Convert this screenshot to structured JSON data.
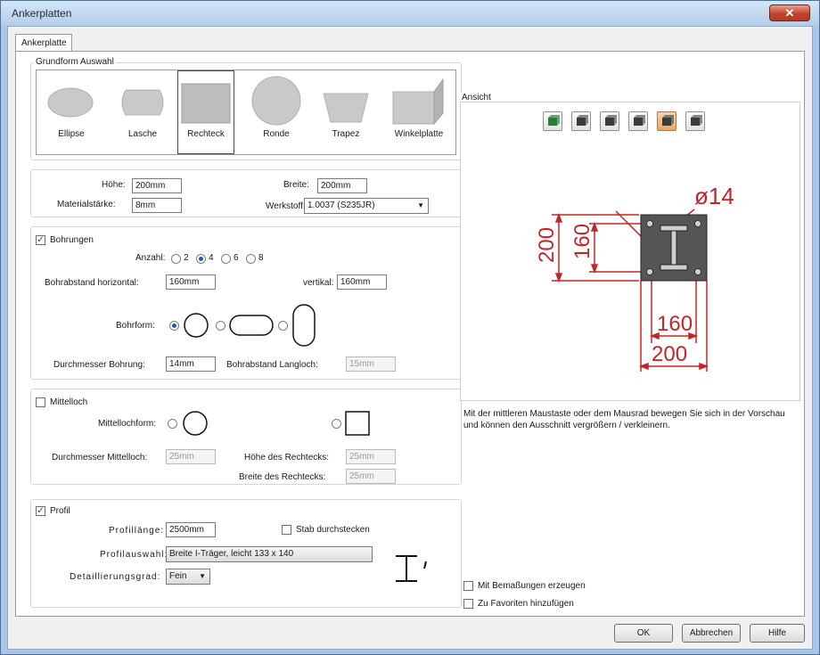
{
  "window": {
    "title": "Ankerplatten",
    "close_label": "✕"
  },
  "tab": {
    "label": "Ankerplatte"
  },
  "shape_group": {
    "label": "Grundform Auswahl",
    "shapes": [
      {
        "label": "Ellipse"
      },
      {
        "label": "Lasche"
      },
      {
        "label": "Rechteck"
      },
      {
        "label": "Ronde"
      },
      {
        "label": "Trapez"
      },
      {
        "label": "Winkelplatte"
      }
    ]
  },
  "dimensions": {
    "hoehe_label": "Höhe:",
    "hoehe_value": "200mm",
    "breite_label": "Breite:",
    "breite_value": "200mm",
    "material_label": "Materialstärke:",
    "material_value": "8mm",
    "werkstoff_label": "Werkstoff:",
    "werkstoff_value": "1.0037 (S235JR)"
  },
  "bohrungen": {
    "label": "Bohrungen",
    "anzahl_label": "Anzahl:",
    "anzahl_options": [
      "2",
      "4",
      "6",
      "8"
    ],
    "abstand_h_label": "Bohrabstand horizontal:",
    "abstand_h_value": "160mm",
    "vertikal_label": "vertikal:",
    "vertikal_value": "160mm",
    "bohrform_label": "Bohrform:",
    "durchmesser_label": "Durchmesser Bohrung:",
    "durchmesser_value": "14mm",
    "langloch_label": "Bohrabstand Langloch:",
    "langloch_value": "15mm"
  },
  "mittelloch": {
    "label": "Mittelloch",
    "form_label": "Mittellochform:",
    "durchmesser_label": "Durchmesser Mittelloch:",
    "durchmesser_value": "25mm",
    "hoehe_label": "Höhe des Rechtecks:",
    "hoehe_value": "25mm",
    "breite_label": "Breite des Rechtecks:",
    "breite_value": "25mm"
  },
  "profil": {
    "label": "Profil",
    "laenge_label": "Profillänge:",
    "laenge_value": "2500mm",
    "stab_label": "Stab durchstecken",
    "auswahl_label": "Profilauswahl:",
    "auswahl_value": "Breite I-Träger, leicht 133 x 140",
    "detail_label": "Detaillierungsgrad:",
    "detail_value": "Fein"
  },
  "ansicht": {
    "label": "Ansicht",
    "dim_diameter": "ø14",
    "dim_200_v": "200",
    "dim_160_v": "160",
    "dim_160_h": "160",
    "dim_200_h": "200",
    "hint": "Mit der mittleren Maustaste oder dem Mausrad bewegen Sie sich in der Vorschau und können den Ausschnitt vergrößern / verkleinern."
  },
  "options": {
    "bemassung_label": "Mit Bemaßungen erzeugen",
    "favoriten_label": "Zu Favoriten hinzufügen"
  },
  "footer": {
    "ok": "OK",
    "abbrechen": "Abbrechen",
    "hilfe": "Hilfe"
  },
  "colors": {
    "dimension": "#c0262a",
    "plate": "#555555",
    "accent": "#1e5aa8"
  }
}
